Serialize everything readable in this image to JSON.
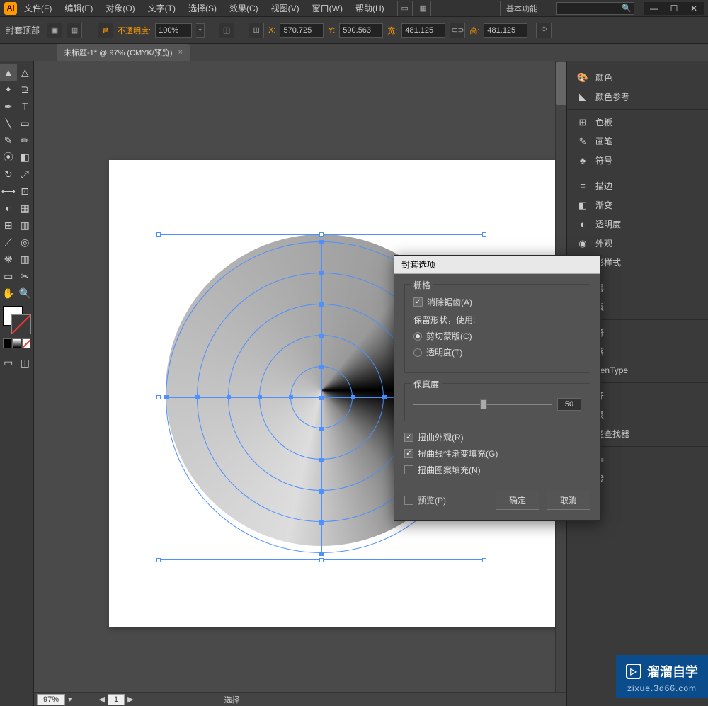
{
  "app": {
    "icon": "Ai"
  },
  "menu": [
    "文件(F)",
    "编辑(E)",
    "对象(O)",
    "文字(T)",
    "选择(S)",
    "效果(C)",
    "视图(V)",
    "窗口(W)",
    "帮助(H)"
  ],
  "workspace": "基本功能",
  "controlbar": {
    "label": "封套顶部",
    "opacity_label": "不透明度:",
    "opacity_value": "100%",
    "x_label": "X:",
    "x_value": "570.725",
    "y_label": "Y:",
    "y_value": "590.563",
    "w_label": "宽:",
    "w_value": "481.125",
    "h_label": "高:",
    "h_value": "481.125"
  },
  "document_tab": "未标题-1* @ 97% (CMYK/预览)",
  "panels": [
    {
      "icon": "🎨",
      "label": "颜色"
    },
    {
      "icon": "▦",
      "label": "颜色参考"
    },
    {
      "icon": "⊞",
      "label": "色板"
    },
    {
      "icon": "✎",
      "label": "画笔"
    },
    {
      "icon": "♣",
      "label": "符号"
    },
    {
      "icon": "≡",
      "label": "描边"
    },
    {
      "icon": "◧",
      "label": "渐变"
    },
    {
      "icon": "◐",
      "label": "透明度"
    },
    {
      "icon": "◉",
      "label": "外观"
    },
    {
      "icon": "",
      "label": "形样式"
    },
    {
      "icon": "",
      "label": "层"
    },
    {
      "icon": "",
      "label": "板"
    },
    {
      "icon": "",
      "label": "符"
    },
    {
      "icon": "",
      "label": "落"
    },
    {
      "icon": "",
      "label": "penType"
    },
    {
      "icon": "",
      "label": "齐"
    },
    {
      "icon": "",
      "label": "换"
    },
    {
      "icon": "",
      "label": "径查找器"
    },
    {
      "icon": "",
      "label": "作"
    },
    {
      "icon": "",
      "label": "接"
    }
  ],
  "dialog": {
    "title": "封套选项",
    "raster_group": "栅格",
    "antialias": "消除锯齿(A)",
    "preserve_shape": "保留形状，使用:",
    "clip_mask": "剪切蒙版(C)",
    "transparency": "透明度(T)",
    "fidelity_group": "保真度",
    "fidelity_value": "50",
    "distort_appearance": "扭曲外观(R)",
    "distort_gradient": "扭曲线性渐变填充(G)",
    "distort_pattern": "扭曲图案填充(N)",
    "preview": "预览(P)",
    "ok": "确定",
    "cancel": "取消"
  },
  "status": {
    "zoom": "97%",
    "artboard": "1",
    "tool": "选择"
  },
  "watermark": {
    "title": "溜溜自学",
    "url": "zixue.3d66.com"
  }
}
